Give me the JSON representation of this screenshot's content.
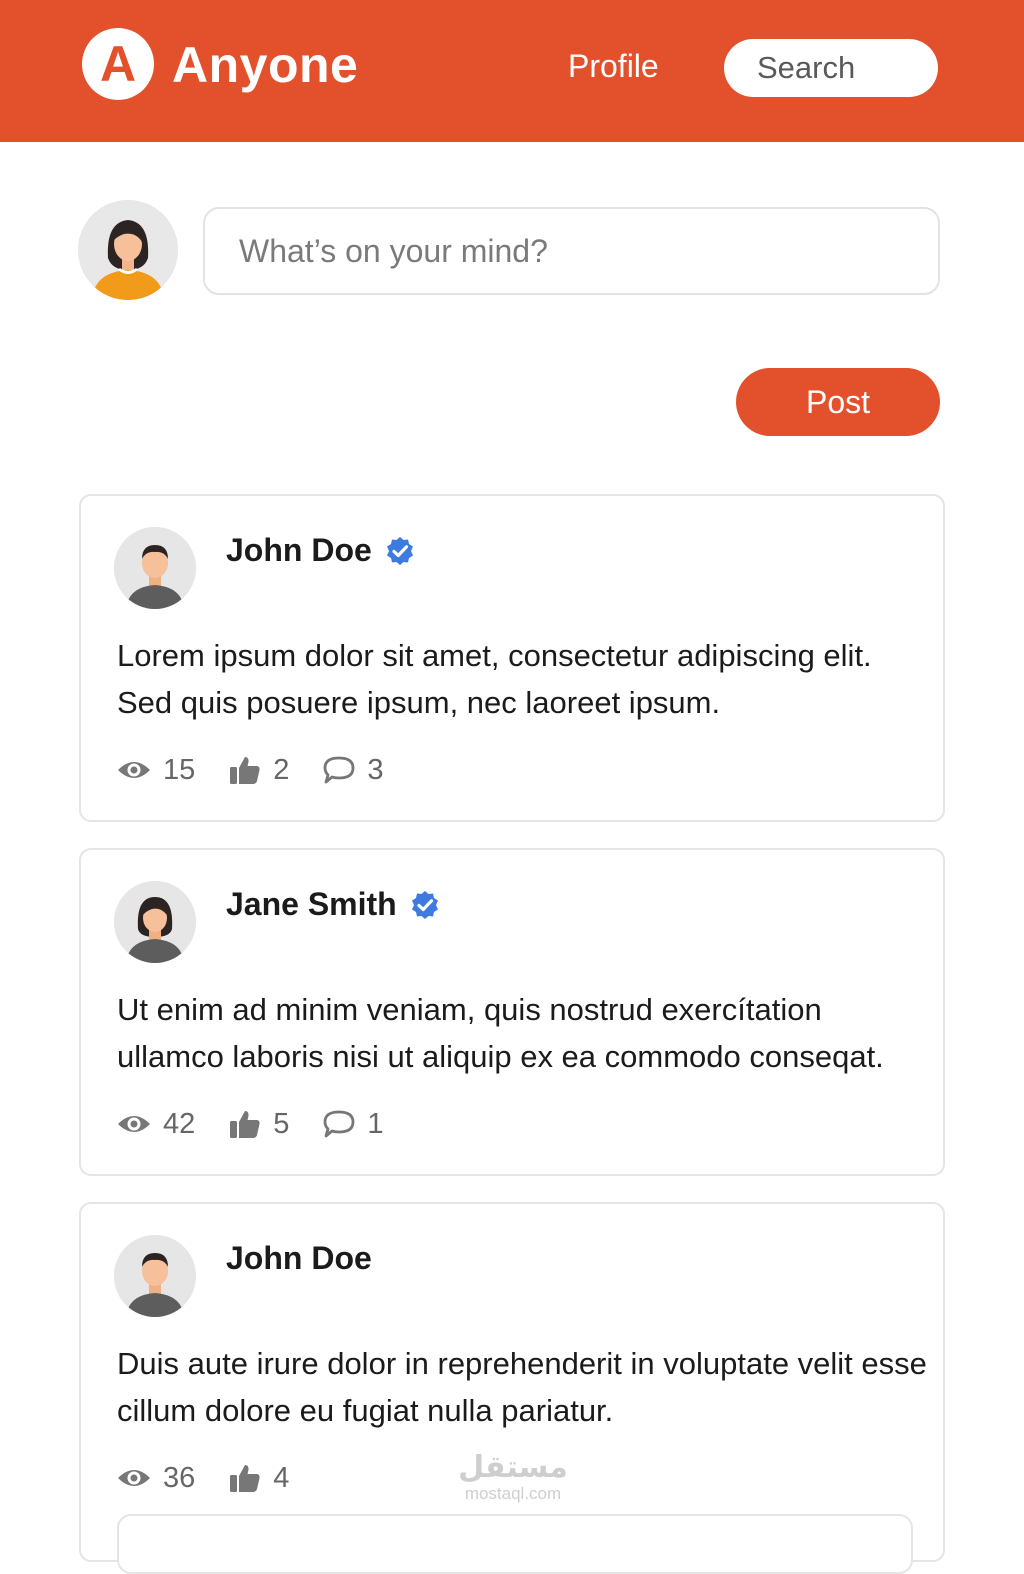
{
  "header": {
    "logo_letter": "A",
    "brand": "Anyone",
    "nav_profile": "Profile",
    "search_placeholder": "Search",
    "background_color": "#e2502c"
  },
  "composer": {
    "placeholder": "What’s on your mind?",
    "post_label": "Post"
  },
  "posts": [
    {
      "author": "John Doe",
      "verified": true,
      "body": "Lorem ipsum dolor sit amet, consectetur adipiscing elit. Sed quis posuere ipsum, nec laoreet ipsum.",
      "views": "15",
      "likes": "2",
      "comments": "3"
    },
    {
      "author": "Jane Smith",
      "verified": true,
      "body": "Ut enim ad minim veniam, quis nostrud exercítation ullamco laboris nisi ut aliquip ex ea commodo conseqat.",
      "views": "42",
      "likes": "5",
      "comments": "1"
    },
    {
      "author": "John Doe",
      "verified": false,
      "body": "Duis aute irure dolor in reprehenderit in voluptate velit esse cillum dolore eu fugiat nulla pariatur.",
      "views": "36",
      "likes": "4"
    }
  ],
  "watermark": {
    "main": "مستقل",
    "sub": "mostaql.com"
  },
  "icons": {
    "views": "eye-icon",
    "likes": "thumbs-up-icon",
    "comments": "comment-bubble-icon",
    "verified": "verified-badge-icon"
  },
  "colors": {
    "accent": "#e2502c",
    "verified": "#3d7be0"
  }
}
